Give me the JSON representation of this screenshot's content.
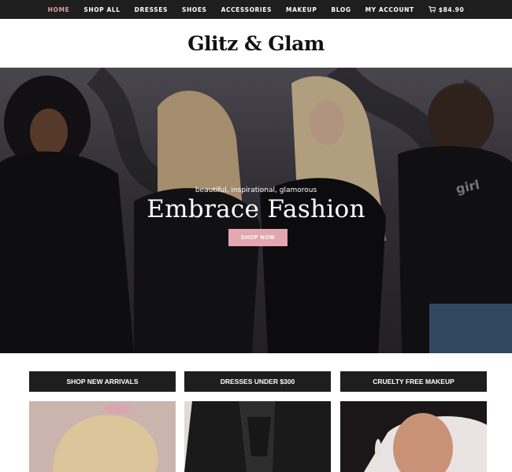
{
  "nav": {
    "items": [
      "HOME",
      "SHOP ALL",
      "DRESSES",
      "SHOES",
      "ACCESSORIES",
      "MAKEUP",
      "BLOG",
      "MY ACCOUNT"
    ],
    "cart_total": "$84.90",
    "cart_icon": "cart-icon",
    "active_color": "#d9a0ad"
  },
  "header": {
    "logo": "Glitz & Glam"
  },
  "hero": {
    "tagline": "beautiful, inspirational, glamorous",
    "title": "Embrace Fashion",
    "button": "SHOP NOW",
    "button_color": "#e3a7b1"
  },
  "categories": [
    {
      "label": "SHOP NEW ARRIVALS"
    },
    {
      "label": "DRESSES UNDER $300"
    },
    {
      "label": "CRUELTY FREE MAKEUP"
    }
  ],
  "colors": {
    "dark": "#1e1e1e",
    "accent": "#e3a7b1"
  }
}
